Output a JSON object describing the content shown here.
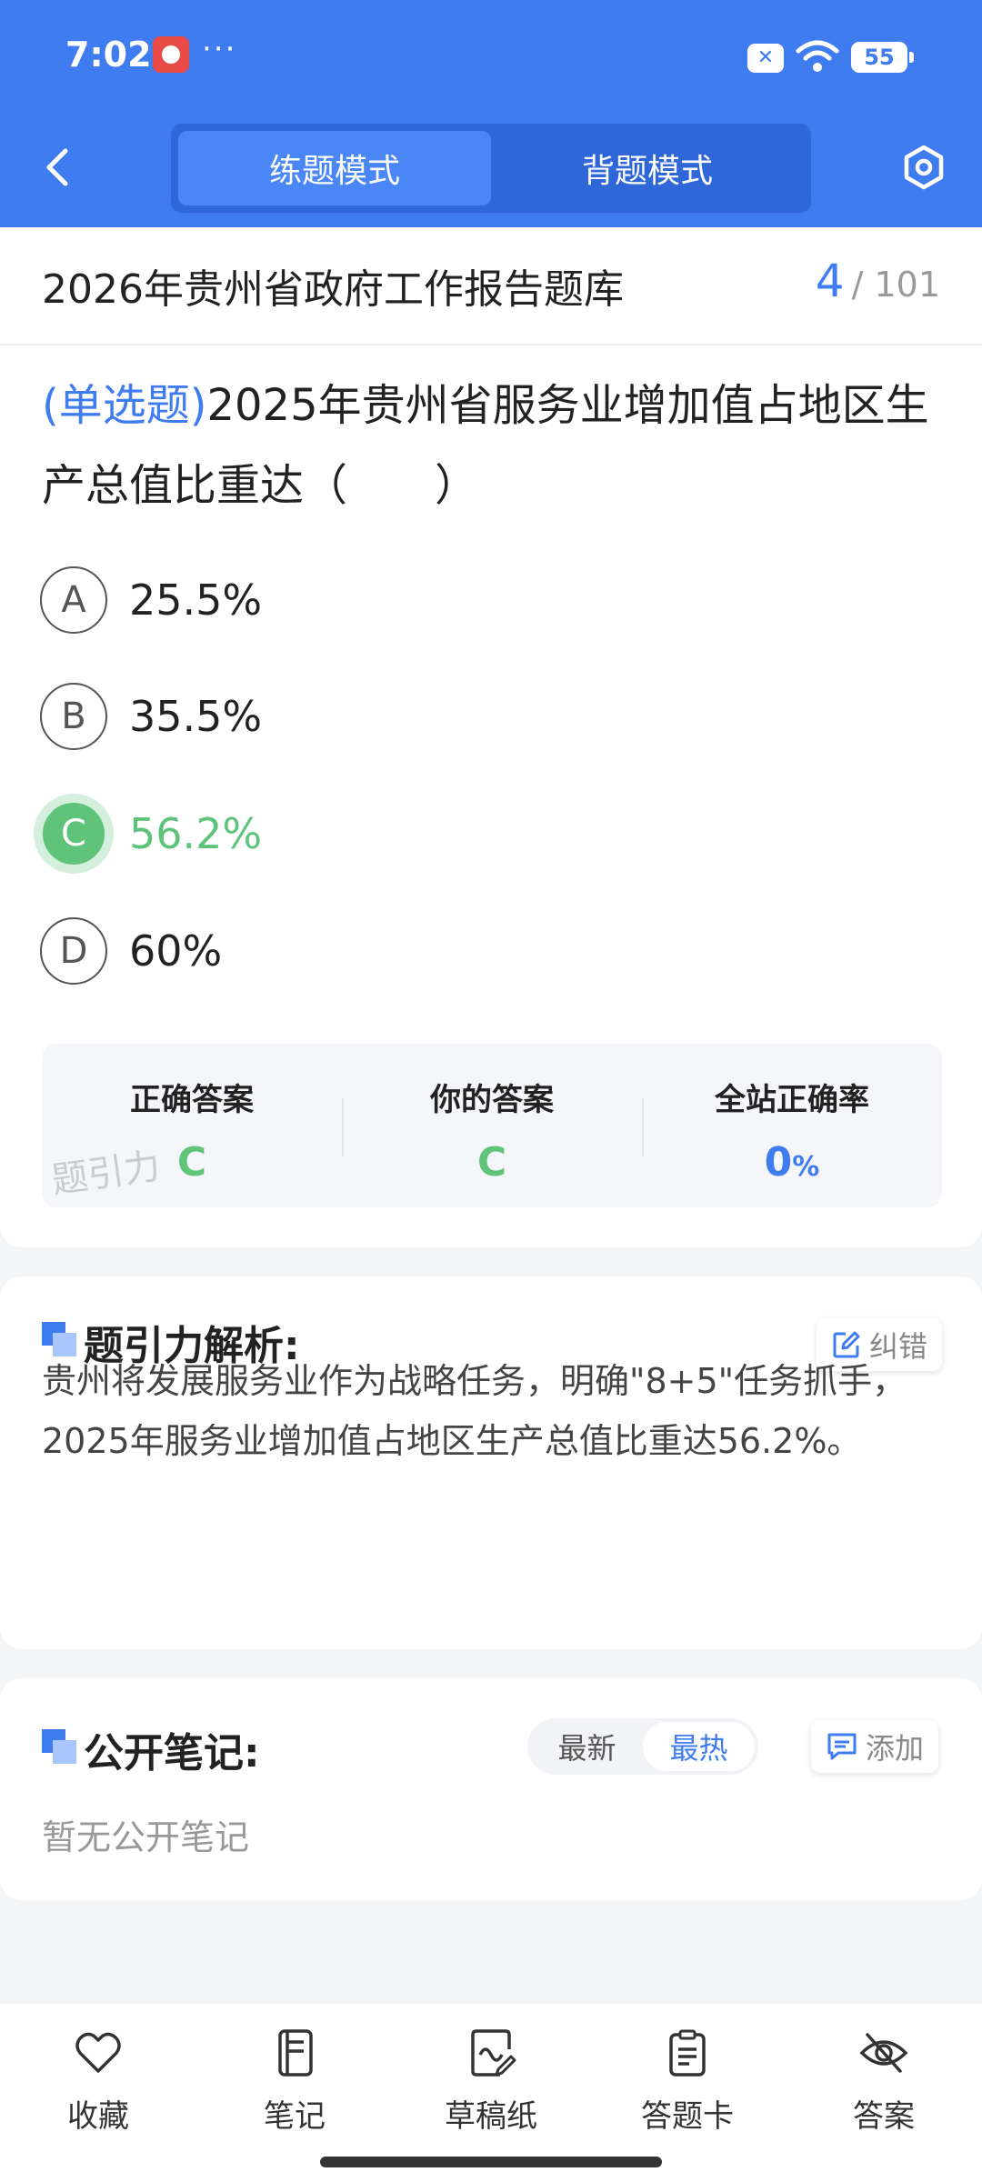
{
  "status_bar": {
    "time": "7:02",
    "dots": "···",
    "battery": "55"
  },
  "header": {
    "tabs": [
      {
        "label": "练题模式",
        "active": true
      },
      {
        "label": "背题模式",
        "active": false
      }
    ],
    "accent": "#3f7cf0"
  },
  "bank": {
    "title": "2026年贵州省政府工作报告题库",
    "current": "4",
    "total": "/ 101"
  },
  "question": {
    "type": "(单选题)",
    "text": "2025年贵州省服务业增加值占地区生产总值比重达（　　）",
    "options": [
      {
        "letter": "A",
        "text": "25.5%",
        "correct": false
      },
      {
        "letter": "B",
        "text": "35.5%",
        "correct": false
      },
      {
        "letter": "C",
        "text": "56.2%",
        "correct": true
      },
      {
        "letter": "D",
        "text": "60%",
        "correct": false
      }
    ]
  },
  "answer_summary": {
    "correct_label": "正确答案",
    "correct_value": "C",
    "yours_label": "你的答案",
    "yours_value": "C",
    "rate_label": "全站正确率",
    "rate_value": "0",
    "rate_unit": "%",
    "watermark": "题引力"
  },
  "analysis": {
    "title": "题引力解析:",
    "report_button": "纠错",
    "text": "贵州将发展服务业作为战略任务，明确\"8+5\"任务抓手，2025年服务业增加值占地区生产总值比重达56.2%。"
  },
  "notes": {
    "title": "公开笔记:",
    "sort_options": [
      {
        "label": "最新",
        "active": false
      },
      {
        "label": "最热",
        "active": true
      }
    ],
    "add_button": "添加",
    "empty_text": "暂无公开笔记"
  },
  "bottom_bar": {
    "items": [
      {
        "label": "收藏",
        "icon": "heart-icon"
      },
      {
        "label": "笔记",
        "icon": "notebook-icon"
      },
      {
        "label": "草稿纸",
        "icon": "draft-paper-icon"
      },
      {
        "label": "答题卡",
        "icon": "answer-sheet-icon"
      },
      {
        "label": "答案",
        "icon": "eye-off-icon"
      }
    ]
  },
  "colors": {
    "correct": "#5fc37a",
    "primary": "#3f7cf0"
  }
}
